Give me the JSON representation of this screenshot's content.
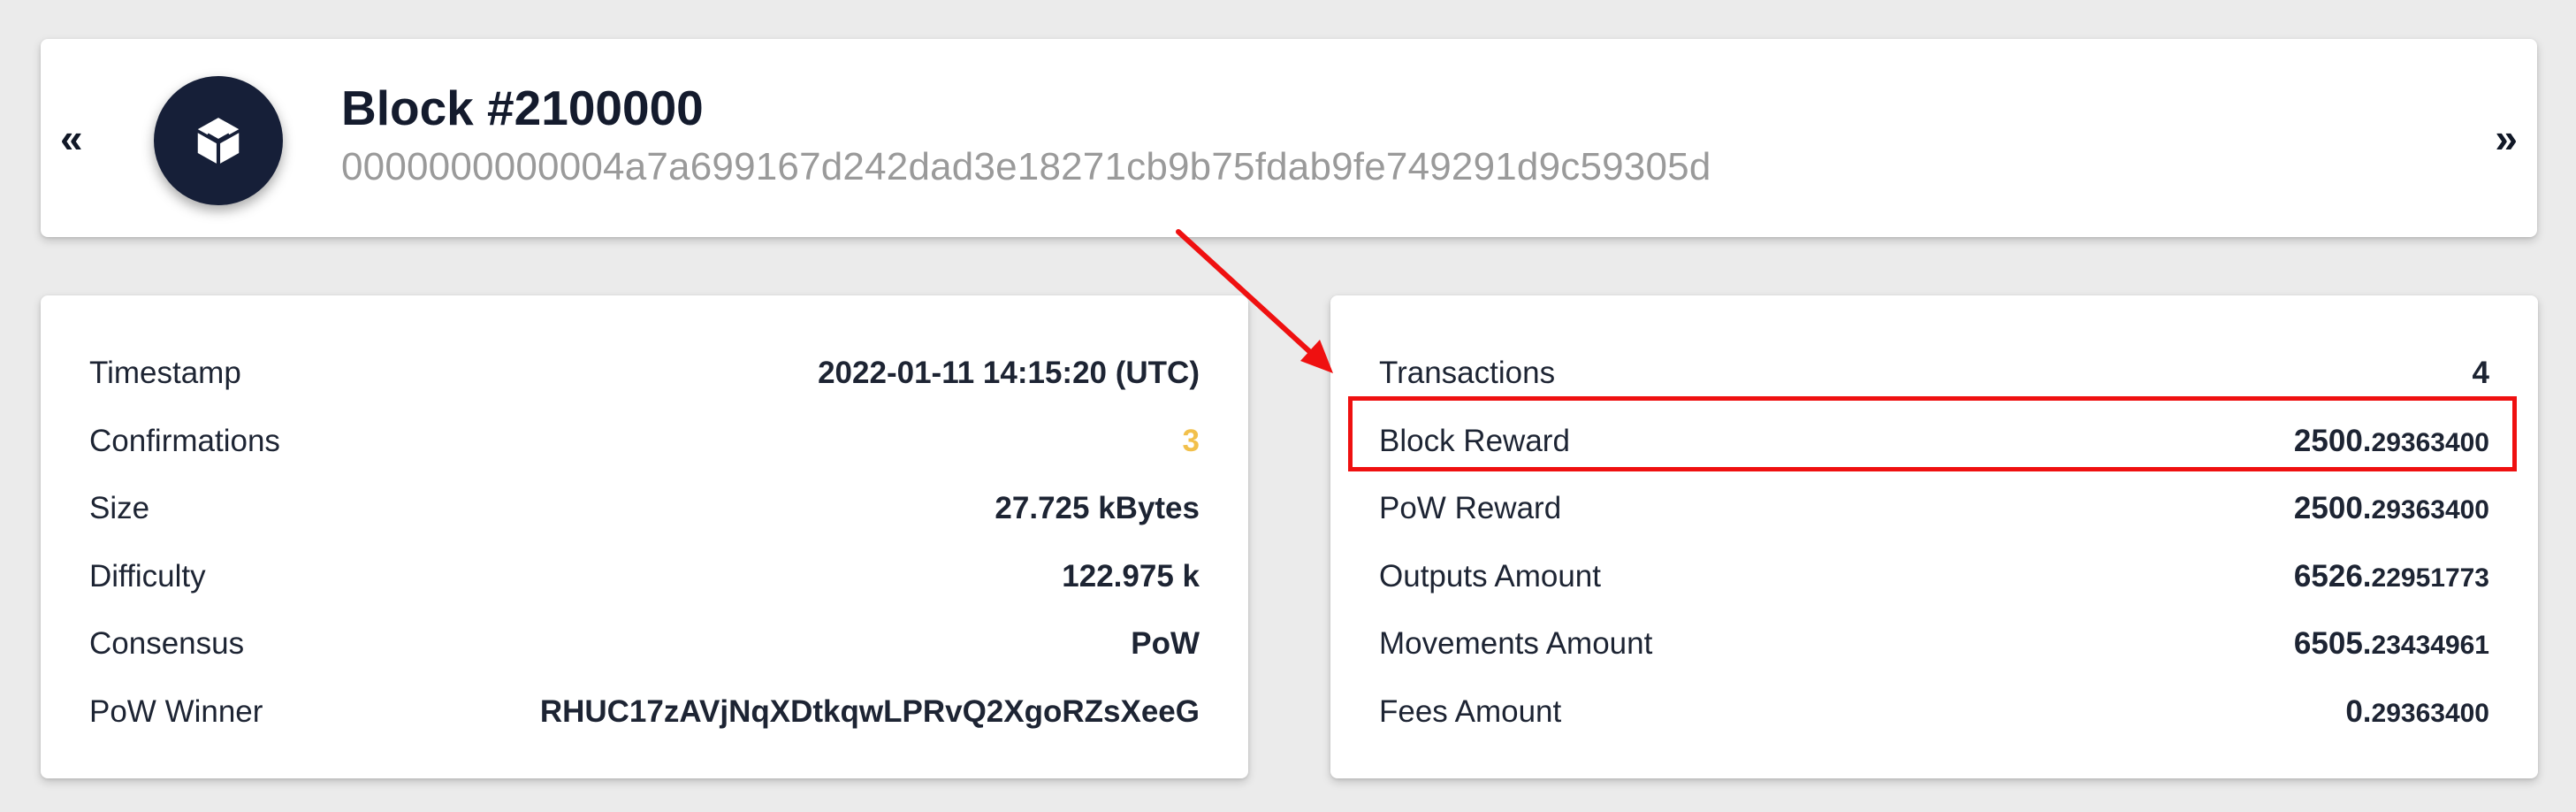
{
  "header": {
    "prev_label": "«",
    "next_label": "»",
    "title": "Block #2100000",
    "hash": "0000000000004a7a699167d242dad3e18271cb9b75fdab9fe749291d9c59305d",
    "icon": "cube-icon"
  },
  "details": [
    {
      "label": "Timestamp",
      "value": "2022-01-11 14:15:20 (UTC)"
    },
    {
      "label": "Confirmations",
      "value": "3"
    },
    {
      "label": "Size",
      "value": "27.725 kBytes"
    },
    {
      "label": "Difficulty",
      "value": "122.975 k"
    },
    {
      "label": "Consensus",
      "value": "PoW"
    },
    {
      "label": "PoW Winner",
      "value": "RHUC17zAVjNqXDtkqwLPRvQ2XgoRZsXeeG"
    }
  ],
  "amounts": [
    {
      "label": "Transactions",
      "value": "4"
    },
    {
      "label": "Block Reward",
      "int": "2500.",
      "dec": "29363400"
    },
    {
      "label": "PoW Reward",
      "int": "2500.",
      "dec": "29363400"
    },
    {
      "label": "Outputs Amount",
      "int": "6526.",
      "dec": "22951773"
    },
    {
      "label": "Movements Amount",
      "int": "6505.",
      "dec": "23434961"
    },
    {
      "label": "Fees Amount",
      "int": "0.",
      "dec": "29363400"
    }
  ],
  "colors": {
    "accent_confirmations": "#f2c04b",
    "annotation_red": "#ef1010",
    "avatar_bg": "#161f38"
  }
}
